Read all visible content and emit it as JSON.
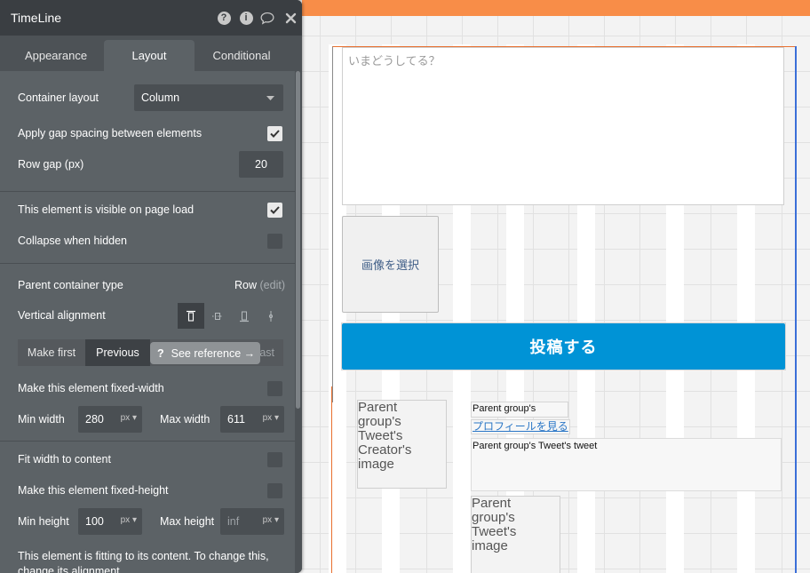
{
  "canvas": {
    "textarea_placeholder": "いまどうしてる？",
    "select_image_label": "画像を選択",
    "post_button_label": "投稿する",
    "creator_image_text": "Parent group's Tweet's Creator's image",
    "parent_group_label": "Parent group's",
    "profile_link_label": "プロフィールを見る",
    "tweet_text_label": "Parent group's Tweet's tweet",
    "tweet_image_text": "Parent group's Tweet's image"
  },
  "panel": {
    "title": "TimeLine",
    "header_icons": [
      "help-icon",
      "info-icon",
      "comment-icon",
      "close-icon"
    ],
    "tabs": [
      {
        "label": "Appearance",
        "active": false
      },
      {
        "label": "Layout",
        "active": true
      },
      {
        "label": "Conditional",
        "active": false
      }
    ],
    "container_layout": {
      "label": "Container layout",
      "value": "Column"
    },
    "gap_spacing": {
      "label": "Apply gap spacing between elements",
      "checked": true
    },
    "row_gap": {
      "label": "Row gap (px)",
      "value": "20"
    },
    "visible_on_load": {
      "label": "This element is visible on page load",
      "checked": true
    },
    "collapse_hidden": {
      "label": "Collapse when hidden",
      "checked": false
    },
    "parent_container": {
      "label": "Parent container type",
      "value": "Row",
      "edit": "(edit)"
    },
    "vertical_alignment": {
      "label": "Vertical alignment",
      "options": [
        "align-top-icon",
        "align-center-icon",
        "align-bottom-icon",
        "align-stretch-icon"
      ],
      "selected": 0
    },
    "order_buttons": {
      "make_first": "Make first",
      "previous": "Previous",
      "make_last_partial": "ast"
    },
    "see_reference": {
      "icon": "?",
      "label": "See reference →"
    },
    "fixed_width": {
      "label": "Make this element fixed-width",
      "checked": false
    },
    "min_width": {
      "label": "Min width",
      "value": "280",
      "unit": "px"
    },
    "max_width": {
      "label": "Max width",
      "value": "611",
      "unit": "px"
    },
    "fit_width": {
      "label": "Fit width to content",
      "checked": false
    },
    "fixed_height": {
      "label": "Make this element fixed-height",
      "checked": false
    },
    "min_height": {
      "label": "Min height",
      "value": "100",
      "unit": "px"
    },
    "max_height": {
      "label": "Max height",
      "value": "inf",
      "unit": "px"
    },
    "fitting_note": "This element is fitting to its content. To change this, change its alignment."
  },
  "colors": {
    "accent_orange": "#f88d48",
    "post_button_blue": "#0093d6",
    "panel_bg": "#5c6266",
    "panel_header": "#3a3e42"
  }
}
